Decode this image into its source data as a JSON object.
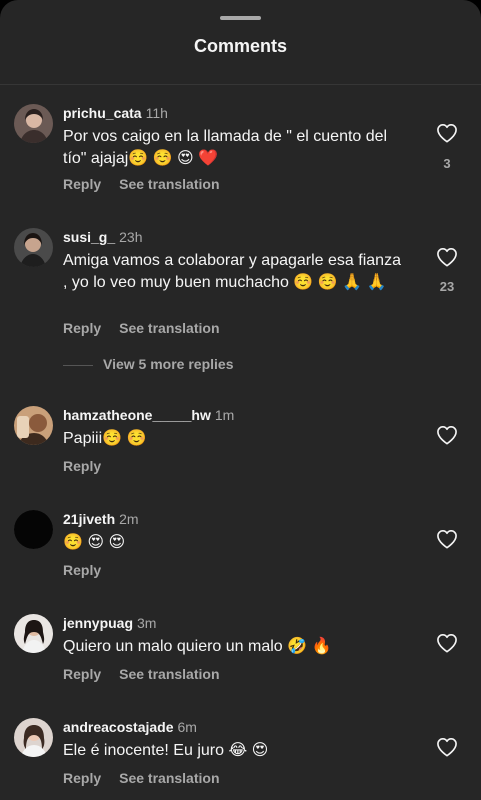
{
  "sheet": {
    "title": "Comments"
  },
  "colors": {
    "background": "#262626",
    "text": "#f5f5f5",
    "muted": "#a8a8a8"
  },
  "comments": [
    {
      "username": "prichu_cata",
      "time": "11h",
      "text": "Por vos caigo en la llamada  de \" el cuento del tío\" ajajaj☺️ ☺️ 😍 ❤️",
      "reply": "Reply",
      "translate": "See translation",
      "likes": "3",
      "avatar_icon": "user-avatar"
    },
    {
      "username": "susi_g_",
      "time": "23h",
      "text": "Amiga vamos a colaborar y apagarle esa fianza , yo lo veo muy buen muchacho ☺️ ☺️ 🙏 🙏",
      "reply": "Reply",
      "translate": "See translation",
      "likes": "23",
      "avatar_icon": "user-avatar",
      "view_more": "View 5 more replies"
    },
    {
      "username": "hamzatheone_____hw",
      "time": "1m",
      "text": "Papiii☺️ ☺️",
      "reply": "Reply",
      "avatar_icon": "user-avatar"
    },
    {
      "username": "21jiveth",
      "time": "2m",
      "text": "☺️ 😍 😍",
      "reply": "Reply",
      "avatar_icon": "user-avatar"
    },
    {
      "username": "jennypuag",
      "time": "3m",
      "text": "Quiero un malo quiero un malo 🤣 🔥",
      "reply": "Reply",
      "translate": "See translation",
      "avatar_icon": "user-avatar"
    },
    {
      "username": "andreacostajade",
      "time": "6m",
      "text": "Ele é inocente! Eu juro 😂 😍",
      "reply": "Reply",
      "translate": "See translation",
      "avatar_icon": "user-avatar"
    }
  ]
}
